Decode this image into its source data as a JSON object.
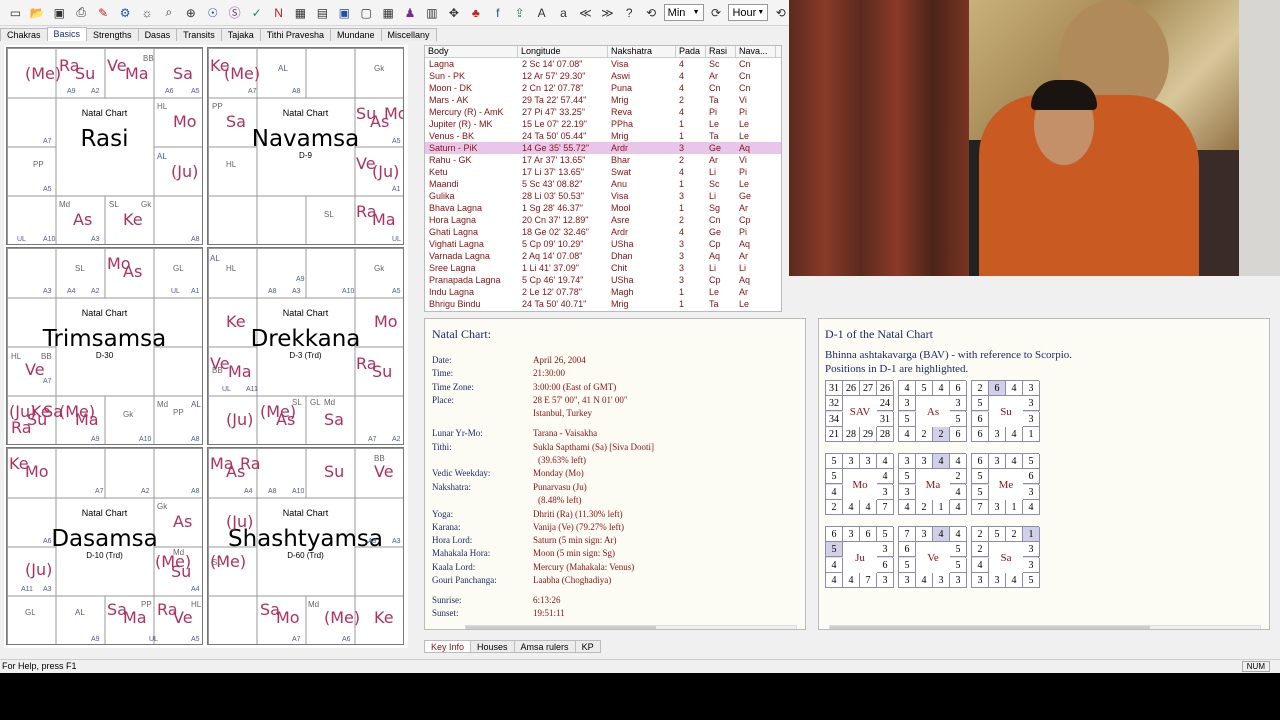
{
  "toolbar": {
    "dropdown1": "Min",
    "dropdown2": "Hour"
  },
  "tabs": [
    "Chakras",
    "Basics",
    "Strengths",
    "Dasas",
    "Transits",
    "Tajaka",
    "Tithi Pravesha",
    "Mundane",
    "Miscellany"
  ],
  "charts": [
    {
      "title": "Natal Chart",
      "name": "Rasi",
      "division": ""
    },
    {
      "title": "Natal Chart",
      "name": "Navamsa",
      "division": "D-9"
    },
    {
      "title": "Natal Chart",
      "name": "Trimsamsa",
      "division": "D-30"
    },
    {
      "title": "Natal Chart",
      "name": "Drekkana",
      "division": "D-3 (Trd)"
    },
    {
      "title": "Natal Chart",
      "name": "Dasamsa",
      "division": "D-10 (Trd)"
    },
    {
      "title": "Natal Chart",
      "name": "Shashtyamsa",
      "division": "D-60 (Trd)"
    }
  ],
  "table": {
    "headers": [
      "Body",
      "Longitude",
      "Nakshatra",
      "Pada",
      "Rasi",
      "Nava..."
    ],
    "rows": [
      [
        "Lagna",
        "2 Sc 14' 07.08\"",
        "Visa",
        "4",
        "Sc",
        "Cn"
      ],
      [
        "Sun - PK",
        "12 Ar 57' 29.30\"",
        "Aswi",
        "4",
        "Ar",
        "Cn"
      ],
      [
        "Moon - DK",
        "2 Cn 12' 07.78\"",
        "Puna",
        "4",
        "Cn",
        "Cn"
      ],
      [
        "Mars - AK",
        "29 Ta 22' 57.44\"",
        "Mrig",
        "2",
        "Ta",
        "Vi"
      ],
      [
        "Mercury (R) - AmK",
        "27 Pi 47' 33.25\"",
        "Reva",
        "4",
        "Pi",
        "Pi"
      ],
      [
        "Jupiter (R) - MK",
        "15 Le 07' 22.19\"",
        "PPha",
        "1",
        "Le",
        "Le"
      ],
      [
        "Venus - BK",
        "24 Ta 50' 05.44\"",
        "Mrig",
        "1",
        "Ta",
        "Le"
      ],
      [
        "Saturn - PiK",
        "14 Ge 35' 55.72\"",
        "Ardr",
        "3",
        "Ge",
        "Aq"
      ],
      [
        "Rahu - GK",
        "17 Ar 37' 13.65\"",
        "Bhar",
        "2",
        "Ar",
        "Vi"
      ],
      [
        "Ketu",
        "17 Li 37' 13.65\"",
        "Swat",
        "4",
        "Li",
        "Pi"
      ],
      [
        "Maandi",
        "5 Sc 43' 08.82\"",
        "Anu",
        "1",
        "Sc",
        "Le"
      ],
      [
        "Gulika",
        "28 Li 03' 50.53\"",
        "Visa",
        "3",
        "Li",
        "Ge"
      ],
      [
        "Bhava Lagna",
        "1 Sg 28' 46.37\"",
        "Mool",
        "1",
        "Sg",
        "Ar"
      ],
      [
        "Hora Lagna",
        "20 Cn 37' 12.89\"",
        "Asre",
        "2",
        "Cn",
        "Cp"
      ],
      [
        "Ghati Lagna",
        "18 Ge 02' 32.46\"",
        "Ardr",
        "4",
        "Ge",
        "Pi"
      ],
      [
        "Vighati Lagna",
        "5 Cp 09' 10.29\"",
        "USha",
        "3",
        "Cp",
        "Aq"
      ],
      [
        "Varnada Lagna",
        "2 Aq 14' 07.08\"",
        "Dhan",
        "3",
        "Aq",
        "Ar"
      ],
      [
        "Sree Lagna",
        "1 Li 41' 37.09\"",
        "Chit",
        "3",
        "Li",
        "Li"
      ],
      [
        "Pranapada Lagna",
        "5 Cp 46' 19.74\"",
        "USha",
        "3",
        "Cp",
        "Aq"
      ],
      [
        "Indu Lagna",
        "2 Le 12' 07.78\"",
        "Magh",
        "1",
        "Le",
        "Ar"
      ],
      [
        "Bhrigu Bindu",
        "24 Ta 50' 40.71\"",
        "Mrig",
        "1",
        "Ta",
        "Le"
      ]
    ]
  },
  "info": {
    "heading": "Natal Chart:",
    "items": [
      {
        "label": "Date:",
        "value": "April 26, 2004"
      },
      {
        "label": "Time:",
        "value": "21:30:00"
      },
      {
        "label": "Time Zone:",
        "value": "3:00:00 (East of GMT)"
      },
      {
        "label": "Place:",
        "value": "28 E 57' 00\", 41 N 01' 00\""
      },
      {
        "label": "",
        "value": "Istanbul, Turkey"
      },
      {
        "label": "Lunar Yr-Mo:",
        "value": "Tarana - Vaisakha"
      },
      {
        "label": "Tithi:",
        "value": "Sukla Sapthami (Sa) [Siva Dooti]"
      },
      {
        "label": "",
        "value": "(39.63% left)"
      },
      {
        "label": "Vedic Weekday:",
        "value": "Monday (Mo)"
      },
      {
        "label": "Nakshatra:",
        "value": "Punarvasu (Ju)"
      },
      {
        "label": "",
        "value": "(8.48% left)"
      },
      {
        "label": "Yoga:",
        "value": "Dhriti (Ra) (11.30% left)"
      },
      {
        "label": "Karana:",
        "value": "Vanija (Ve) (79.27% left)"
      },
      {
        "label": "Hora Lord:",
        "value": "Saturn (5 min sign: Ar)"
      },
      {
        "label": "Mahakala Hora:",
        "value": "Moon (5 min sign: Sg)"
      },
      {
        "label": "Kaala Lord:",
        "value": "Mercury (Mahakala: Venus)"
      },
      {
        "label": "Gouri Panchanga:",
        "value": "Laabha (Choghadiya)"
      },
      {
        "label": "Sunrise:",
        "value": "6:13:26"
      },
      {
        "label": "Sunset:",
        "value": "19:51:11"
      }
    ]
  },
  "bav": {
    "heading": "D-1 of the Natal Chart",
    "line1": "Bhinna ashtakavarga (BAV) - with reference to Scorpio.",
    "line2": "Positions in D-1 are highlighted.",
    "grids": [
      {
        "name": "SAV",
        "cells": [
          "31",
          "26",
          "27",
          "26",
          "24",
          "31",
          "28",
          "29",
          "28",
          "21",
          "34",
          "32"
        ]
      },
      {
        "name": "As",
        "cells": [
          "4",
          "5",
          "4",
          "6",
          "3",
          "5",
          "6",
          "2",
          "2",
          "4",
          "5",
          "3"
        ]
      },
      {
        "name": "Su",
        "cells": [
          "2",
          "6",
          "4",
          "3",
          "3",
          "3",
          "1",
          "4",
          "3",
          "6",
          "6",
          "5"
        ]
      },
      {
        "name": "Mo",
        "cells": [
          "5",
          "3",
          "3",
          "4",
          "4",
          "3",
          "7",
          "4",
          "4",
          "2",
          "4",
          "5"
        ]
      },
      {
        "name": "Ma",
        "cells": [
          "3",
          "3",
          "4",
          "4",
          "2",
          "4",
          "4",
          "1",
          "2",
          "4",
          "3",
          "5"
        ]
      },
      {
        "name": "Me",
        "cells": [
          "6",
          "3",
          "4",
          "5",
          "6",
          "3",
          "4",
          "1",
          "3",
          "7",
          "5",
          "5"
        ]
      },
      {
        "name": "Ju",
        "cells": [
          "6",
          "3",
          "6",
          "5",
          "3",
          "6",
          "3",
          "7",
          "4",
          "4",
          "4",
          "5"
        ]
      },
      {
        "name": "Ve",
        "cells": [
          "7",
          "3",
          "4",
          "4",
          "5",
          "5",
          "3",
          "3",
          "4",
          "3",
          "5",
          "6"
        ]
      },
      {
        "name": "Sa",
        "cells": [
          "2",
          "5",
          "2",
          "1",
          "3",
          "3",
          "5",
          "4",
          "3",
          "3",
          "4",
          "2"
        ]
      }
    ]
  },
  "bottom_tabs": [
    "Key Info",
    "Houses",
    "Amsa rulers",
    "KP"
  ],
  "status": "For Help, press F1",
  "status_num": "NUM"
}
